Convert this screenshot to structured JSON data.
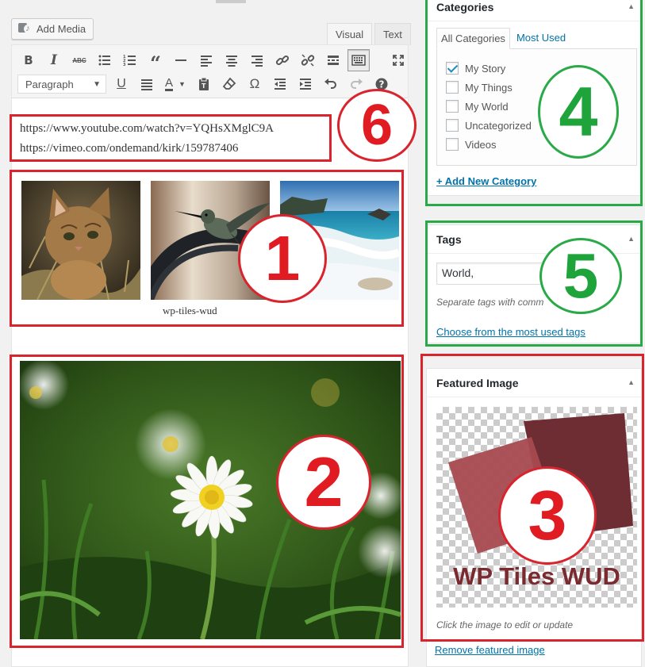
{
  "editor": {
    "add_media_label": "Add Media",
    "tabs": {
      "visual": "Visual",
      "text": "Text"
    },
    "format_select": "Paragraph",
    "urls": [
      "https://www.youtube.com/watch?v=YQHsXMglC9A",
      "https://vimeo.com/ondemand/kirk/159787406"
    ],
    "gallery_caption": "wp-tiles-wud",
    "toolbar_icons": [
      "bold",
      "italic",
      "strikethrough",
      "bullet-list",
      "numbered-list",
      "blockquote",
      "horizontal-line",
      "align-left",
      "align-center",
      "align-right",
      "link",
      "unlink",
      "read-more",
      "toolbar-toggle",
      "fullscreen",
      "underline",
      "justify",
      "text-color",
      "paste-as-text",
      "clear-formatting",
      "special-character",
      "outdent",
      "indent",
      "undo",
      "redo",
      "help"
    ]
  },
  "categories": {
    "title": "Categories",
    "tab_all": "All Categories",
    "tab_most_used": "Most Used",
    "items": [
      {
        "label": "My Story",
        "checked": true
      },
      {
        "label": "My Things",
        "checked": false
      },
      {
        "label": "My World",
        "checked": false
      },
      {
        "label": "Uncategorized",
        "checked": false
      },
      {
        "label": "Videos",
        "checked": false
      }
    ],
    "add_new": "+ Add New Category"
  },
  "tags": {
    "title": "Tags",
    "input_value": "World,",
    "hint": "Separate tags with comm",
    "choose_link": "Choose from the most used tags"
  },
  "featured_image": {
    "title": "Featured Image",
    "logo_text": "WP Tiles WUD",
    "hint": "Click the image to edit or update",
    "remove_link": "Remove featured image"
  },
  "annotations": {
    "n1": "1",
    "n2": "2",
    "n3": "3",
    "n4": "4",
    "n5": "5",
    "n6": "6"
  },
  "colors": {
    "annotation_red": "#d9232d",
    "annotation_green": "#29a947",
    "link_blue": "#0073aa",
    "logo_dark_red": "#7b2a30"
  }
}
